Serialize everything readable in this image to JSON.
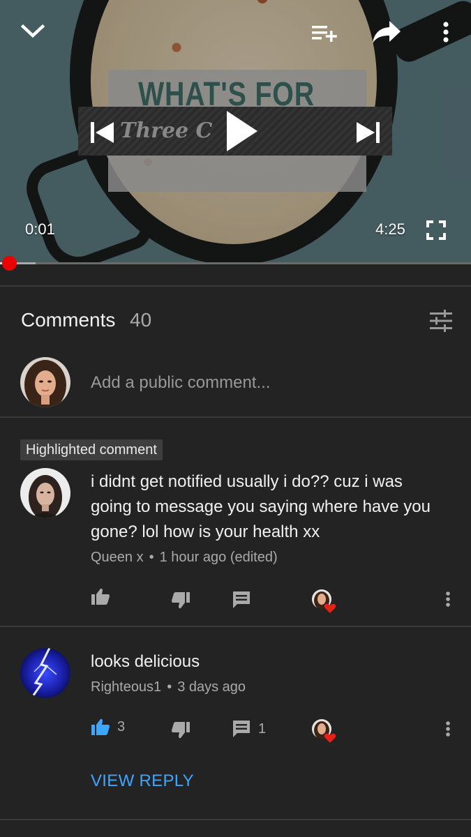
{
  "player": {
    "overlay_title": "WHAT'S FOR",
    "overlay_banner": "Three C",
    "current_time": "0:01",
    "duration": "4:25",
    "progress_fraction": 0.004,
    "buffered_fraction": 0.075
  },
  "comments_header": {
    "title": "Comments",
    "count": "40"
  },
  "add_comment": {
    "placeholder": "Add a public comment..."
  },
  "comments": [
    {
      "badge": "Highlighted comment",
      "lines": [
        "i didnt get notified usually i do?? cuz i was",
        "going to message you saying where have you",
        "gone? lol how is your health xx"
      ],
      "author": "Queen x",
      "time": "1 hour ago (edited)",
      "like_count": "",
      "reply_count": ""
    },
    {
      "lines": [
        "looks delicious"
      ],
      "author": "Righteous1",
      "time": "3 days ago",
      "like_count": "3",
      "reply_count": "1",
      "view_reply": "VIEW REPLY"
    }
  ],
  "colors": {
    "background": "#232323",
    "accent_blue": "#3ea6ff",
    "progress_red": "#ee0000",
    "heart_red": "#e62117"
  }
}
